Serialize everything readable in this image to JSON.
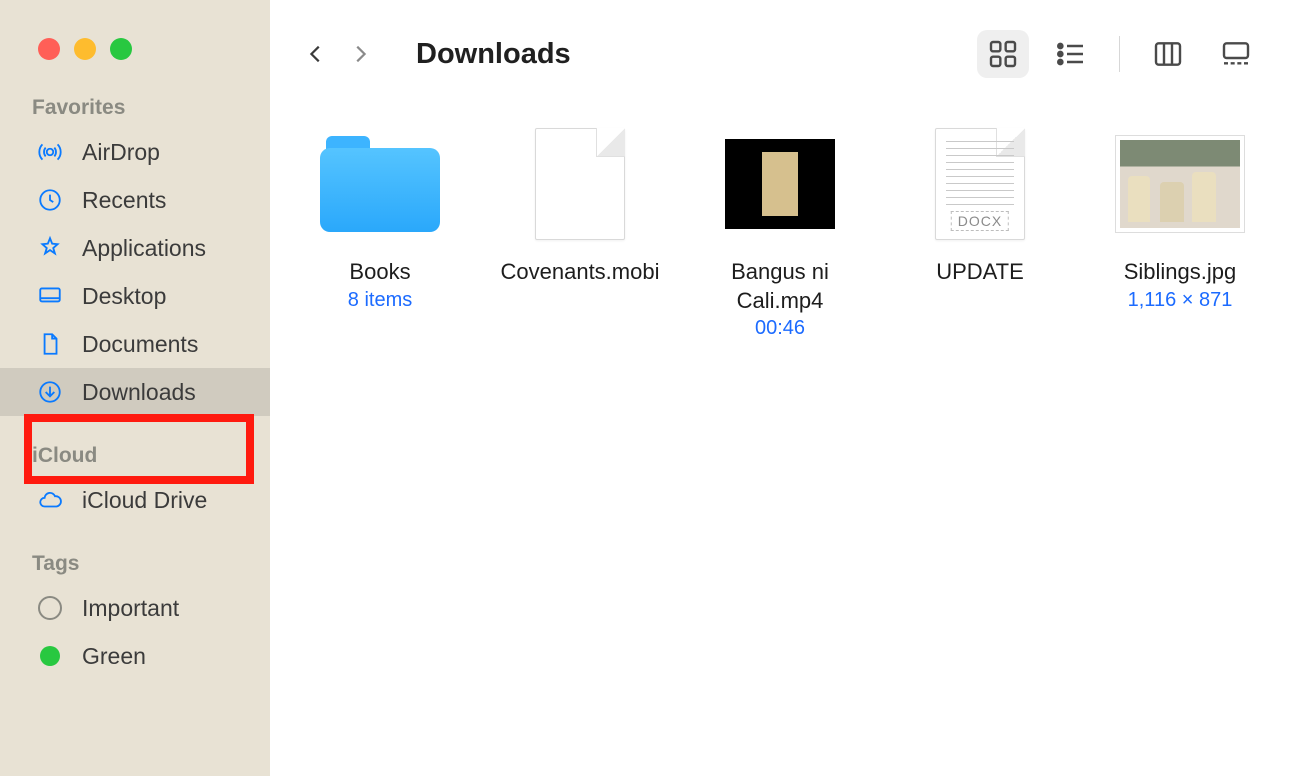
{
  "window": {
    "title": "Downloads"
  },
  "sidebar": {
    "sections": {
      "favorites": {
        "label": "Favorites"
      },
      "icloud": {
        "label": "iCloud"
      },
      "tags": {
        "label": "Tags"
      }
    },
    "favorites": [
      {
        "icon": "airdrop",
        "label": "AirDrop"
      },
      {
        "icon": "clock",
        "label": "Recents"
      },
      {
        "icon": "apps",
        "label": "Applications"
      },
      {
        "icon": "desktop",
        "label": "Desktop"
      },
      {
        "icon": "document",
        "label": "Documents"
      },
      {
        "icon": "download",
        "label": "Downloads",
        "selected": true,
        "highlighted": true
      }
    ],
    "icloud": [
      {
        "icon": "cloud",
        "label": "iCloud Drive"
      }
    ],
    "tags": [
      {
        "color": "none",
        "label": "Important"
      },
      {
        "color": "#28c840",
        "label": "Green"
      }
    ]
  },
  "toolbar": {
    "back_enabled": true,
    "forward_enabled": false,
    "views": {
      "icon": "Icon view",
      "list": "List view",
      "column": "Column view",
      "gallery": "Gallery view",
      "active": "icon"
    }
  },
  "files": [
    {
      "kind": "folder",
      "name": "Books",
      "meta": "8 items"
    },
    {
      "kind": "mobi",
      "name": "Covenants.mobi",
      "meta": ""
    },
    {
      "kind": "video",
      "name": "Bangus ni Cali.mp4",
      "meta": "00:46"
    },
    {
      "kind": "docx",
      "name": "UPDATE",
      "meta": "",
      "badge": "DOCX"
    },
    {
      "kind": "image",
      "name": "Siblings.jpg",
      "meta": "1,116 × 871"
    }
  ]
}
